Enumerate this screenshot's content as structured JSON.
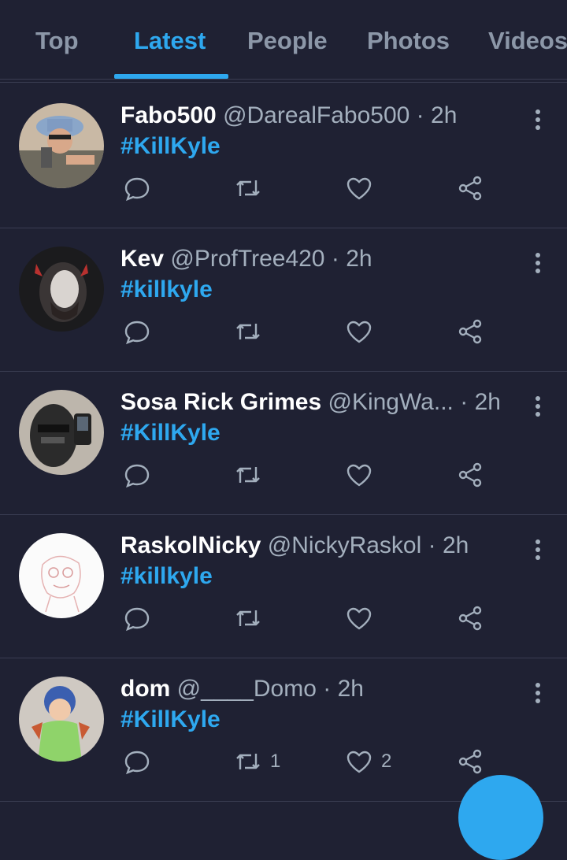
{
  "tabs": [
    {
      "label": "Top",
      "active": false
    },
    {
      "label": "Latest",
      "active": true
    },
    {
      "label": "People",
      "active": false
    },
    {
      "label": "Photos",
      "active": false
    },
    {
      "label": "Videos",
      "active": false
    }
  ],
  "colors": {
    "background": "#1f2133",
    "accent": "#2ea8ef",
    "muted": "#a3afbd",
    "divider": "#3a3d52"
  },
  "tweets": [
    {
      "name": "Fabo500",
      "handle": "@DarealFabo500",
      "dot": "·",
      "time": "2h",
      "text": "#KillKyle",
      "retweets": "",
      "likes": "",
      "avatar": "avatar-rapper-icon"
    },
    {
      "name": "Kev",
      "handle": "@ProfTree420",
      "dot": "·",
      "time": "2h",
      "text": "#killkyle",
      "retweets": "",
      "likes": "",
      "avatar": "avatar-devil-horns-icon"
    },
    {
      "name": "Sosa Rick Grimes",
      "handle": "@KingWa...",
      "dot": "·",
      "time": "2h",
      "text": "#KillKyle",
      "retweets": "",
      "likes": "",
      "avatar": "avatar-masked-selfie-icon"
    },
    {
      "name": "RaskolNicky",
      "handle": "@NickyRaskol",
      "dot": "·",
      "time": "2h",
      "text": "#killkyle",
      "retweets": "",
      "likes": "",
      "avatar": "avatar-sketch-icon"
    },
    {
      "name": "dom",
      "handle": "@____Domo",
      "dot": "·",
      "time": "2h",
      "text": "#KillKyle",
      "retweets": "1",
      "likes": "2",
      "avatar": "avatar-baby-costume-icon"
    }
  ]
}
